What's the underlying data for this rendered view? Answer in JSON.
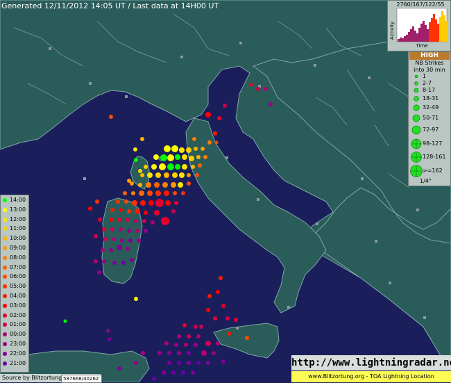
{
  "header": {
    "title": "Generated 12/11/2012 14:05 UT / Last data at 14H00 UT"
  },
  "activity_graph": {
    "title": "2760/167/122/55",
    "ylabel": "Activity",
    "xlabel": "Time"
  },
  "strike_legend": {
    "level": "HIGH",
    "heading_1": "NB Strikes",
    "heading_2": "into 30 min",
    "items": [
      "1",
      "2-7",
      "8-17",
      "18-31",
      "32-49",
      "50-71",
      "72-97",
      "98-127",
      "128-161",
      ">=162"
    ],
    "scale": "1/4°"
  },
  "time_legend": {
    "items": [
      "14:00",
      "13:00",
      "12:00",
      "11:00",
      "10:00",
      "09:00",
      "08:00",
      "07:00",
      "06:00",
      "05:00",
      "04:00",
      "03:00",
      "02:00",
      "01:00",
      "00:00",
      "23:00",
      "22:00",
      "21:00"
    ],
    "colors": [
      "#00ff00",
      "#ffff00",
      "#ffe400",
      "#ffd000",
      "#ffb400",
      "#ff9a00",
      "#ff8000",
      "#ff6400",
      "#ff4a00",
      "#ff3000",
      "#ff1800",
      "#ff0000",
      "#e8002c",
      "#d00050",
      "#b40070",
      "#9a0088",
      "#800098",
      "#6a00a8"
    ]
  },
  "footer": {
    "source": "Source by Blitzortung",
    "code": "587668/40262",
    "url": "http://www.lightningradar.net",
    "credit": "www.Blitzortung.org - TOA Lightning Location"
  },
  "colors": {
    "sea": "#1a1f5c",
    "land": "#2a5c5a",
    "border": "#7fa7a6",
    "legend_bg": "#b9c6c2"
  }
}
